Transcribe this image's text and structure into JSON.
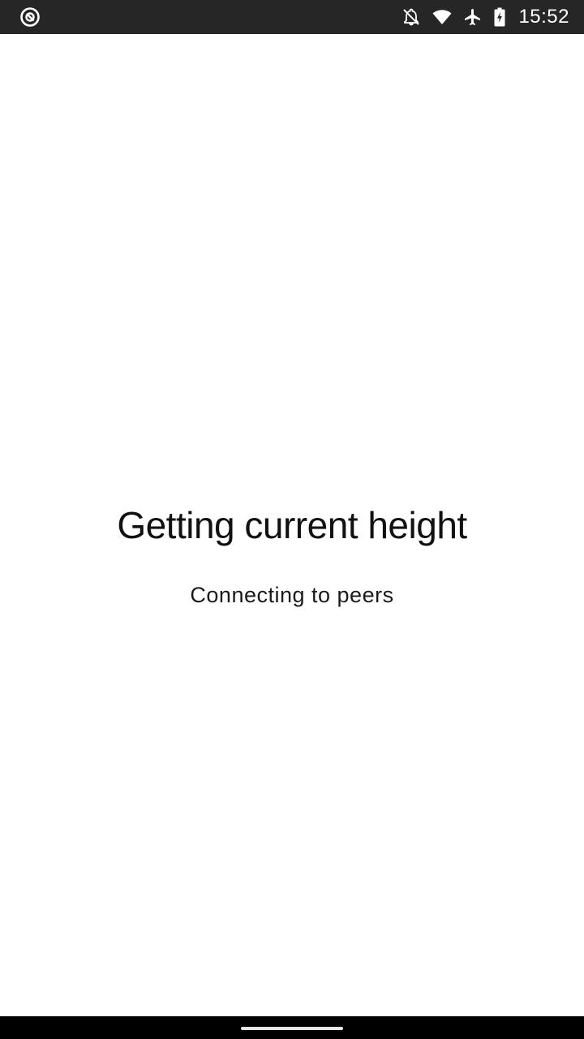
{
  "status_bar": {
    "time": "15:52",
    "icons": [
      "app-notification-icon",
      "do-not-disturb-off-icon",
      "wifi-icon",
      "airplane-mode-icon",
      "battery-charging-icon"
    ]
  },
  "main": {
    "title": "Getting current height",
    "subtitle": "Connecting to peers"
  },
  "colors": {
    "status_bar_bg": "#262626",
    "background": "#ffffff",
    "nav_bar_bg": "#000000"
  }
}
